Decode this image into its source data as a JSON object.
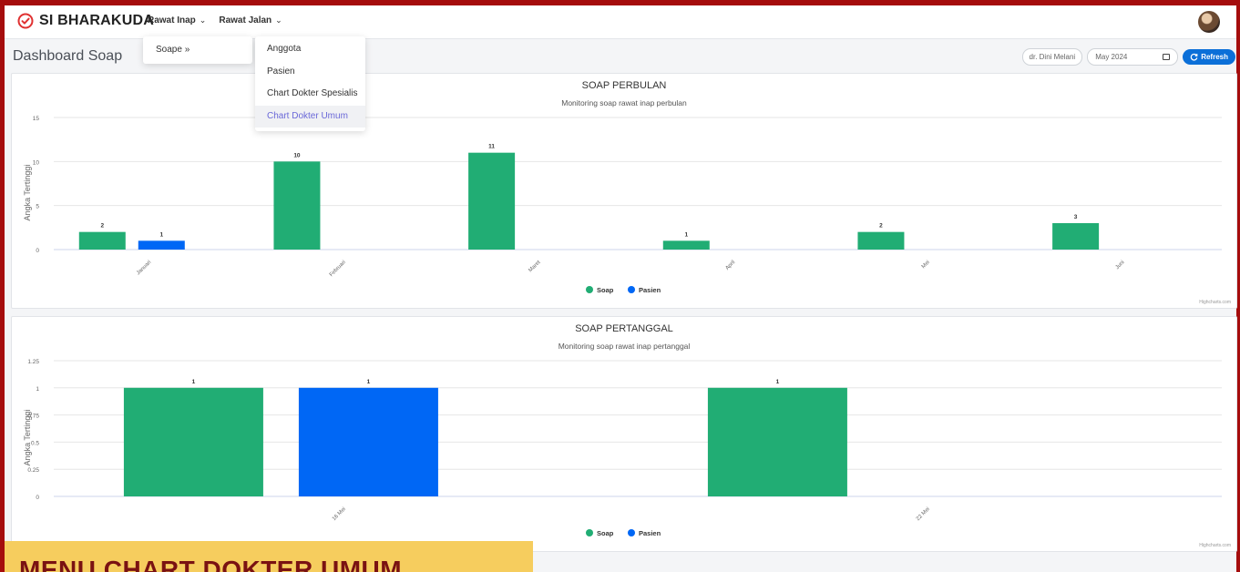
{
  "app": {
    "title": "SI BHARAKUDA",
    "logo_icon": "check-circle-icon",
    "brand_color": "#e03131"
  },
  "nav": {
    "rawat_inap": "Rawat Inap",
    "rawat_jalan": "Rawat Jalan",
    "chevron": "⌄"
  },
  "submenu": {
    "soape": "Soape »"
  },
  "dropdown": {
    "items": [
      "Anggota",
      "Pasien",
      "Chart Dokter Spesialis",
      "Chart Dokter Umum"
    ],
    "active_index": 3
  },
  "page": {
    "title": "Dashboard Soap"
  },
  "controls": {
    "doctor": "dr. Dini Melani",
    "month": "May 2024",
    "refresh": "Refresh"
  },
  "colors": {
    "soap": "#21ad74",
    "pasien": "#0067f5",
    "frame": "#a50d0d",
    "refresh": "#0b6fd8"
  },
  "chart_data": [
    {
      "type": "bar",
      "title": "SOAP PERBULAN",
      "subtitle": "Monitoring soap rawat inap perbulan",
      "ylabel": "Angka Tertinggi",
      "ylim": [
        0,
        15
      ],
      "yticks": [
        "0",
        "5",
        "10",
        "15"
      ],
      "categories": [
        "Januari",
        "Februari",
        "Maret",
        "April",
        "Mei",
        "Juni"
      ],
      "series": [
        {
          "name": "Soap",
          "values": [
            2,
            10,
            11,
            1,
            2,
            3
          ]
        },
        {
          "name": "Pasien",
          "values": [
            1,
            null,
            null,
            null,
            null,
            null
          ]
        }
      ],
      "credit": "Highcharts.com"
    },
    {
      "type": "bar",
      "title": "SOAP PERTANGGAL",
      "subtitle": "Monitoring soap rawat inap pertanggal",
      "ylabel": "Angka Tertinggi",
      "ylim": [
        0,
        1.25
      ],
      "yticks": [
        "0",
        "0.25",
        "0.5",
        "0.75",
        "1",
        "1.25"
      ],
      "categories": [
        "16 Mei",
        "22 Mei"
      ],
      "series": [
        {
          "name": "Soap",
          "values": [
            1,
            1
          ]
        },
        {
          "name": "Pasien",
          "values": [
            1,
            null
          ]
        }
      ],
      "credit": "Highcharts.com"
    }
  ],
  "caption": {
    "text": "MENU CHART DOKTER UMUM"
  }
}
